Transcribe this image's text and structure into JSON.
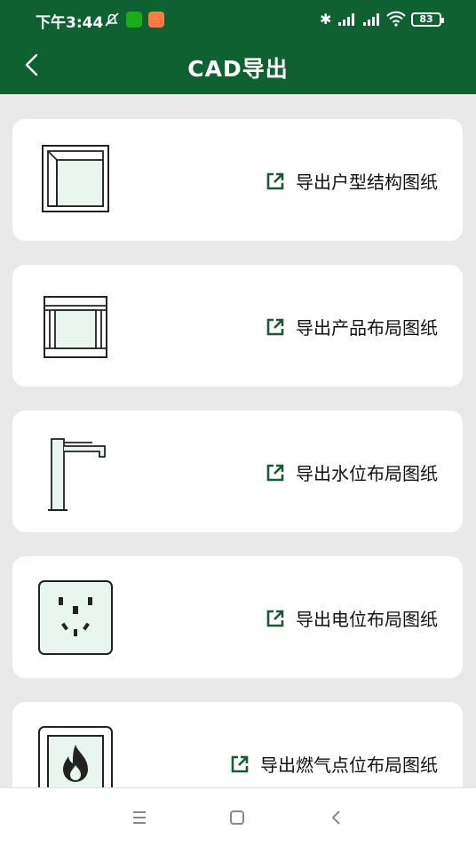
{
  "status": {
    "time": "下午3:44",
    "battery": "83"
  },
  "header": {
    "title": "CAD导出"
  },
  "items": [
    {
      "label": "导出户型结构图纸",
      "icon": "floor-plan-structure-icon"
    },
    {
      "label": "导出产品布局图纸",
      "icon": "cabinet-layout-icon"
    },
    {
      "label": "导出水位布局图纸",
      "icon": "faucet-icon"
    },
    {
      "label": "导出电位布局图纸",
      "icon": "power-socket-icon"
    },
    {
      "label": "导出燃气点位布局图纸",
      "icon": "gas-flame-icon"
    }
  ],
  "colors": {
    "brand": "#0f6132",
    "accent": "#1a5a35",
    "background": "#e9e9e9"
  }
}
